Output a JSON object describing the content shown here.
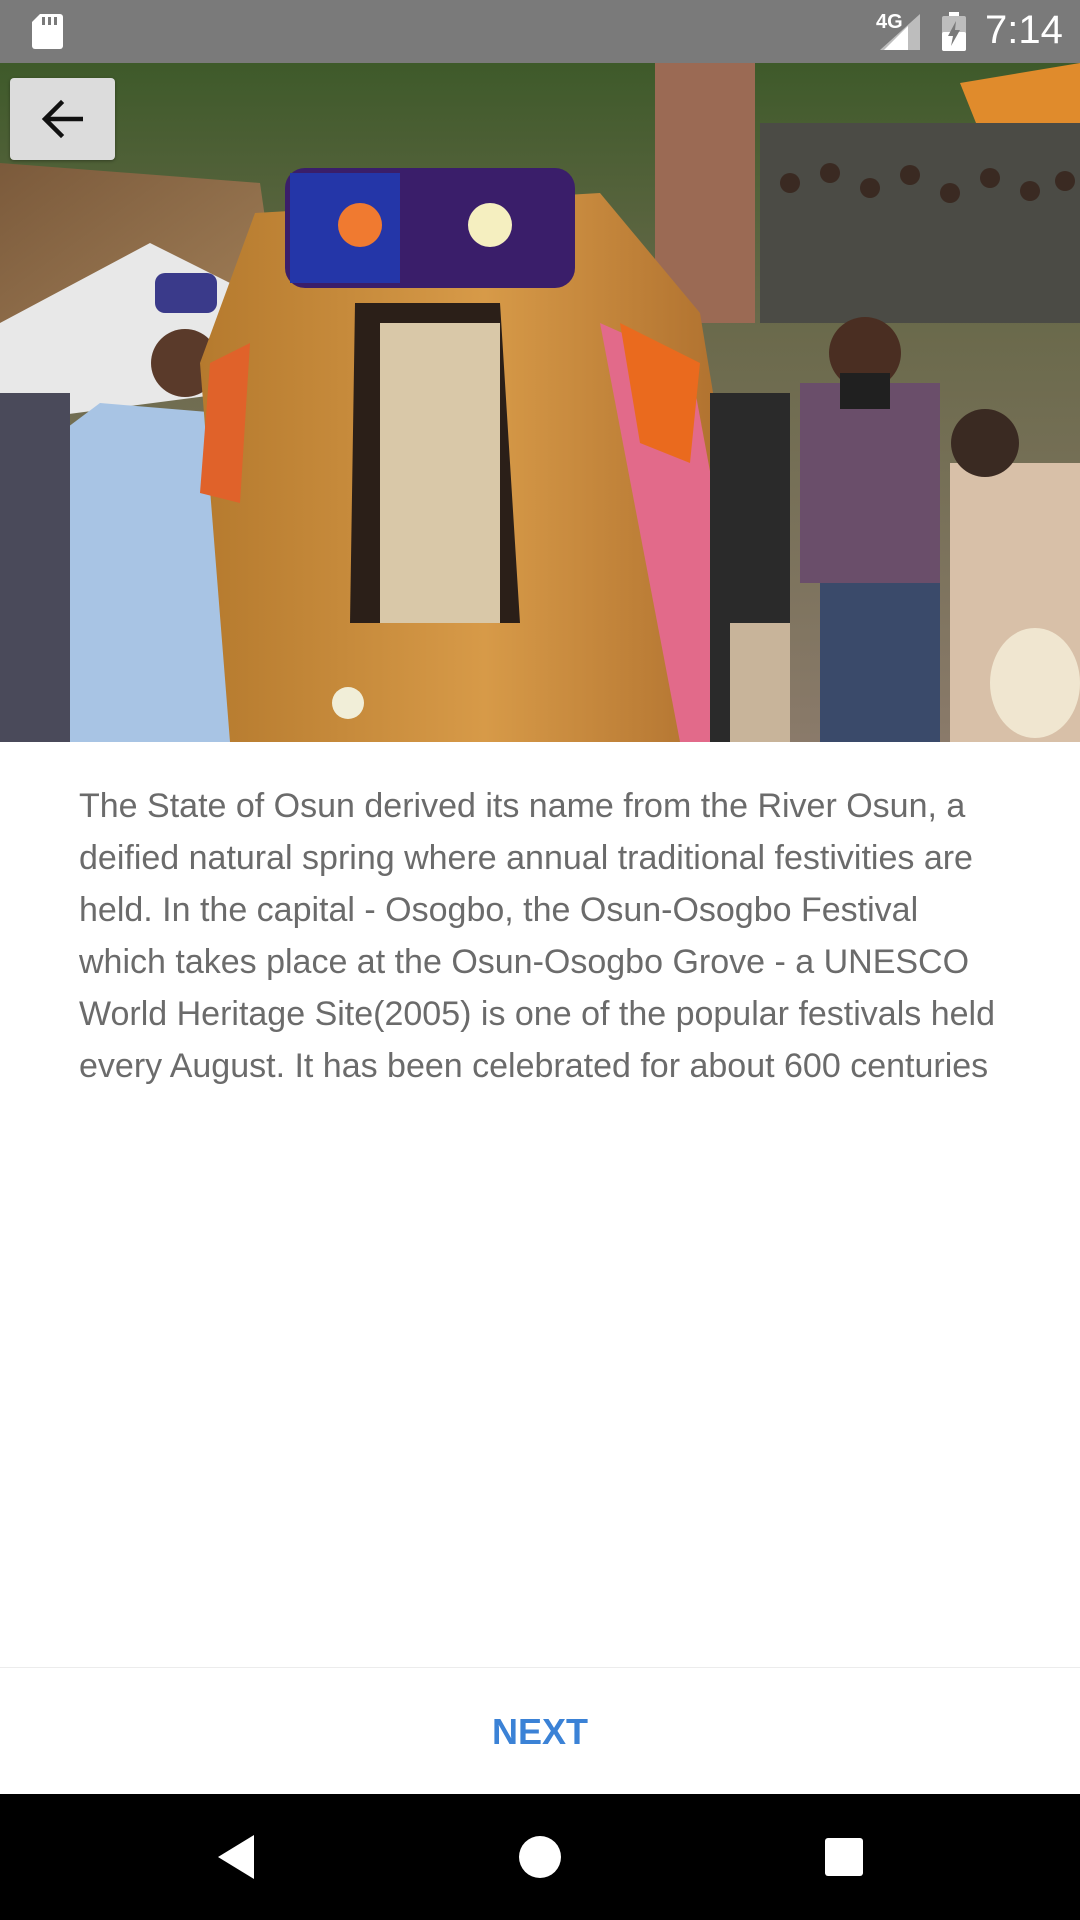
{
  "status_bar": {
    "network_type": "4G",
    "time": "7:14",
    "icons": [
      "sd-card-icon",
      "signal-icon",
      "battery-icon"
    ]
  },
  "hero": {
    "image": "festival-photo",
    "back_icon": "arrow-left-icon"
  },
  "content": {
    "description": "The State of Osun derived its name from the River Osun, a deified natural spring where annual traditional festivities are held. In the capital - Osogbo, the Osun-Osogbo Festival which takes place at the Osun-Osogbo Grove - a UNESCO World Heritage Site(2005) is one of the popular festivals held every August. It has been celebrated for about 600 centuries"
  },
  "footer": {
    "next_label": "NEXT"
  },
  "nav_bar": {
    "icons": [
      "nav-back-icon",
      "nav-home-icon",
      "nav-recents-icon"
    ]
  },
  "colors": {
    "status_bar": "#7a7a7a",
    "accent": "#3b82d6",
    "text": "#6b6b6b",
    "nav_bar": "#000000"
  }
}
